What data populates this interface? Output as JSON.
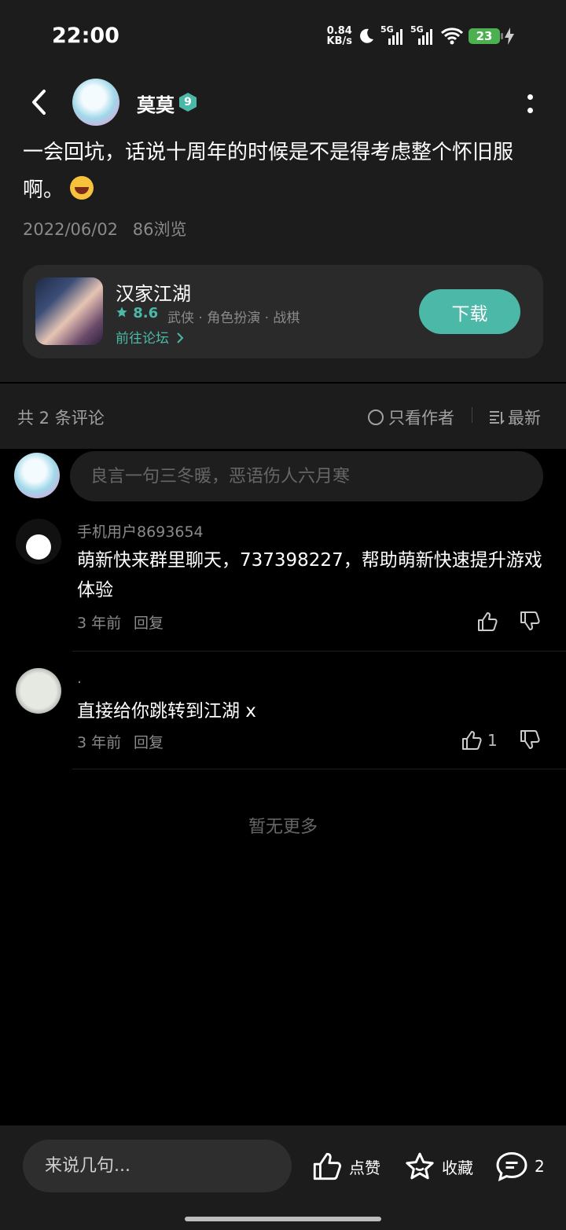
{
  "status": {
    "time": "22:00",
    "netspeed_value": "0.84",
    "netspeed_unit": "KB/s",
    "signal1": "5G",
    "signal2": "5G",
    "battery": "23"
  },
  "post": {
    "author": "莫莫",
    "level": "9",
    "text": "一会回坑，话说十周年的时候是不是得考虑整个怀旧服啊。",
    "emoji": "joy-emoji",
    "date": "2022/06/02",
    "views": "86浏览"
  },
  "game": {
    "name": "汉家江湖",
    "rating": "8.6",
    "tags": "武侠 · 角色扮演 · 战棋",
    "forum_link": "前往论坛",
    "download_label": "下载"
  },
  "comments_header": {
    "count_label": "共 2 条评论",
    "only_author": "只看作者",
    "sort": "最新"
  },
  "comment_input": {
    "placeholder": "良言一句三冬暖，恶语伤人六月寒"
  },
  "comments": [
    {
      "user": "手机用户8693654",
      "text": "萌新快来群里聊天，737398227，帮助萌新快速提升游戏体验",
      "time": "3 年前",
      "reply": "回复",
      "likes": ""
    },
    {
      "user": ".",
      "text": "直接给你跳转到江湖 x",
      "time": "3 年前",
      "reply": "回复",
      "likes": "1"
    }
  ],
  "no_more": "暂无更多",
  "bottom": {
    "say_placeholder": "来说几句...",
    "like_label": "点赞",
    "favorite_label": "收藏",
    "comment_count": "2"
  }
}
